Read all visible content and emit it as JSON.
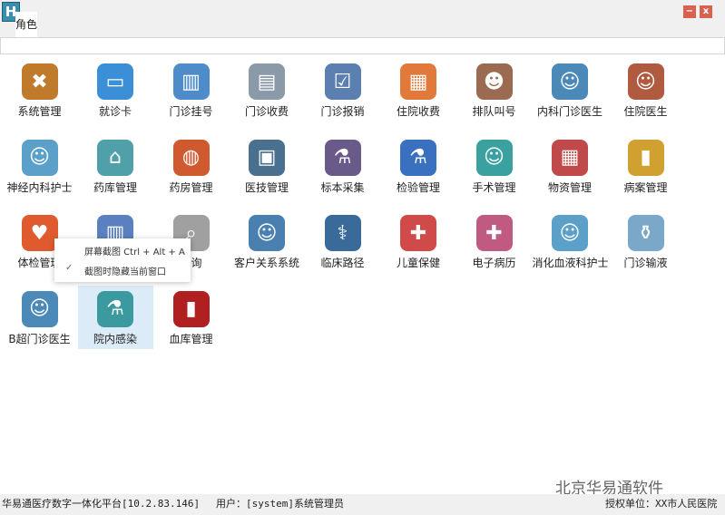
{
  "window": {
    "logo": "H",
    "tab": "角色",
    "minimize": "−",
    "close": "x"
  },
  "items": [
    {
      "label": "系统管理",
      "icon": "tools-icon",
      "color": "#c07a2c",
      "glyph": "✖"
    },
    {
      "label": "就诊卡",
      "icon": "card-icon",
      "color": "#3a8fd6",
      "glyph": "▭"
    },
    {
      "label": "门诊挂号",
      "icon": "building-icon",
      "color": "#4d8cc8",
      "glyph": "▥"
    },
    {
      "label": "门诊收费",
      "icon": "cash-register-icon",
      "color": "#8a9aa8",
      "glyph": "▤"
    },
    {
      "label": "门诊报销",
      "icon": "clipboard-icon",
      "color": "#5a7fb0",
      "glyph": "☑"
    },
    {
      "label": "住院收费",
      "icon": "calendar-icon",
      "color": "#e0793a",
      "glyph": "▦"
    },
    {
      "label": "排队叫号",
      "icon": "people-icon",
      "color": "#9a6b50",
      "glyph": "☻"
    },
    {
      "label": "内科门诊医生",
      "icon": "doctor-icon",
      "color": "#4b8ab8",
      "glyph": "☺"
    },
    {
      "label": "住院医生",
      "icon": "doctor-icon",
      "color": "#b05a40",
      "glyph": "☺"
    },
    {
      "label": "神经内科护士",
      "icon": "nurse-icon",
      "color": "#5aa0c8",
      "glyph": "☺"
    },
    {
      "label": "药库管理",
      "icon": "warehouse-icon",
      "color": "#4fa0a8",
      "glyph": "⌂"
    },
    {
      "label": "药房管理",
      "icon": "medicine-icon",
      "color": "#d05a30",
      "glyph": "◍"
    },
    {
      "label": "医技管理",
      "icon": "xray-icon",
      "color": "#4a7090",
      "glyph": "▣"
    },
    {
      "label": "标本采集",
      "icon": "microscope-icon",
      "color": "#6a5a8a",
      "glyph": "⚗"
    },
    {
      "label": "检验管理",
      "icon": "flask-icon",
      "color": "#3a70c0",
      "glyph": "⚗"
    },
    {
      "label": "手术管理",
      "icon": "surgeon-icon",
      "color": "#3aa0a0",
      "glyph": "☺"
    },
    {
      "label": "物资管理",
      "icon": "boxes-icon",
      "color": "#c04a4a",
      "glyph": "▦"
    },
    {
      "label": "病案管理",
      "icon": "binders-icon",
      "color": "#d0a030",
      "glyph": "▮"
    },
    {
      "label": "体检管理",
      "icon": "heart-monitor-icon",
      "color": "#e05a30",
      "glyph": "♥"
    },
    {
      "label": "",
      "icon": "report-chart-icon",
      "color": "#5a80c0",
      "glyph": "▥"
    },
    {
      "label": "查询",
      "icon": "search-doctor-icon",
      "color": "#a0a0a0",
      "glyph": "⌕"
    },
    {
      "label": "客户关系系统",
      "icon": "contact-card-icon",
      "color": "#4a80b0",
      "glyph": "☺"
    },
    {
      "label": "临床路径",
      "icon": "stethoscope-icon",
      "color": "#3a6a9a",
      "glyph": "⚕"
    },
    {
      "label": "儿童保健",
      "icon": "mother-child-icon",
      "color": "#d04a4a",
      "glyph": "✚"
    },
    {
      "label": "电子病历",
      "icon": "medical-record-icon",
      "color": "#c05a80",
      "glyph": "✚"
    },
    {
      "label": "消化血液科护士",
      "icon": "nurse-icon",
      "color": "#5aa0c8",
      "glyph": "☺"
    },
    {
      "label": "门诊输液",
      "icon": "iv-bag-icon",
      "color": "#7aa8c8",
      "glyph": "⚱"
    },
    {
      "label": "B超门诊医生",
      "icon": "doctor-icon",
      "color": "#4b8ab8",
      "glyph": "☺"
    },
    {
      "label": "院内感染",
      "icon": "microscope-icon",
      "color": "#3a9aa0",
      "glyph": "⚗"
    },
    {
      "label": "血库管理",
      "icon": "blood-bag-icon",
      "color": "#b02020",
      "glyph": "▮"
    }
  ],
  "popup": {
    "item1": "屏幕截图 Ctrl + Alt + A",
    "item2": "截图时隐藏当前窗口",
    "check": "✓"
  },
  "status": {
    "platform": "华易通医疗数字一体化平台[10.2.83.146]",
    "user": "用户：[system]系统管理员",
    "org": "授权单位：XX市人民医院"
  },
  "watermark": "北京华易通软件"
}
